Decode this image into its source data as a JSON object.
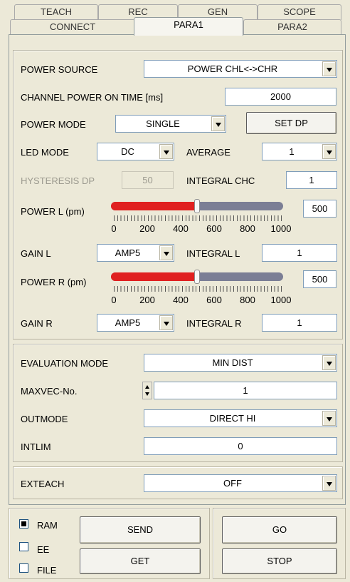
{
  "tabs_row1": [
    "TEACH",
    "REC",
    "GEN",
    "SCOPE"
  ],
  "tabs_row2": [
    "CONNECT",
    "PARA1",
    "PARA2"
  ],
  "power_source": {
    "label": "POWER SOURCE",
    "value": "POWER CHL<->CHR"
  },
  "channel_power_on_time": {
    "label": "CHANNEL POWER ON TIME [ms]",
    "value": "2000"
  },
  "power_mode": {
    "label": "POWER MODE",
    "value": "SINGLE",
    "set_dp": "SET DP"
  },
  "led_mode": {
    "label": "LED MODE",
    "value": "DC"
  },
  "average": {
    "label": "AVERAGE",
    "value": "1"
  },
  "hysteresis_dp": {
    "label": "HYSTERESIS DP",
    "value": "50"
  },
  "integral_chc": {
    "label": "INTEGRAL CHC",
    "value": "1"
  },
  "power_l": {
    "label": "POWER L (pm)",
    "value": "500",
    "level": 500,
    "max": 1000
  },
  "gain_l": {
    "label": "GAIN L",
    "value": "AMP5"
  },
  "integral_l": {
    "label": "INTEGRAL L",
    "value": "1"
  },
  "power_r": {
    "label": "POWER R (pm)",
    "value": "500",
    "level": 500,
    "max": 1000
  },
  "gain_r": {
    "label": "GAIN R",
    "value": "AMP5"
  },
  "integral_r": {
    "label": "INTEGRAL R",
    "value": "1"
  },
  "slider_ticks": [
    "0",
    "200",
    "400",
    "600",
    "800",
    "1000"
  ],
  "evaluation_mode": {
    "label": "EVALUATION MODE",
    "value": "MIN DIST"
  },
  "maxvec": {
    "label": "MAXVEC-No.",
    "value": "1"
  },
  "outmode": {
    "label": "OUTMODE",
    "value": "DIRECT HI"
  },
  "intlim": {
    "label": "INTLIM",
    "value": "0"
  },
  "exteach": {
    "label": "EXTEACH",
    "value": "OFF"
  },
  "memory": {
    "ram": {
      "label": "RAM",
      "checked": true
    },
    "ee": {
      "label": "EE",
      "checked": false
    },
    "file": {
      "label": "FILE",
      "checked": false
    }
  },
  "buttons": {
    "send": "SEND",
    "get": "GET",
    "go": "GO",
    "stop": "STOP"
  },
  "colors": {
    "slider_fill": "#e02020",
    "slider_track": "#7b7e95"
  }
}
